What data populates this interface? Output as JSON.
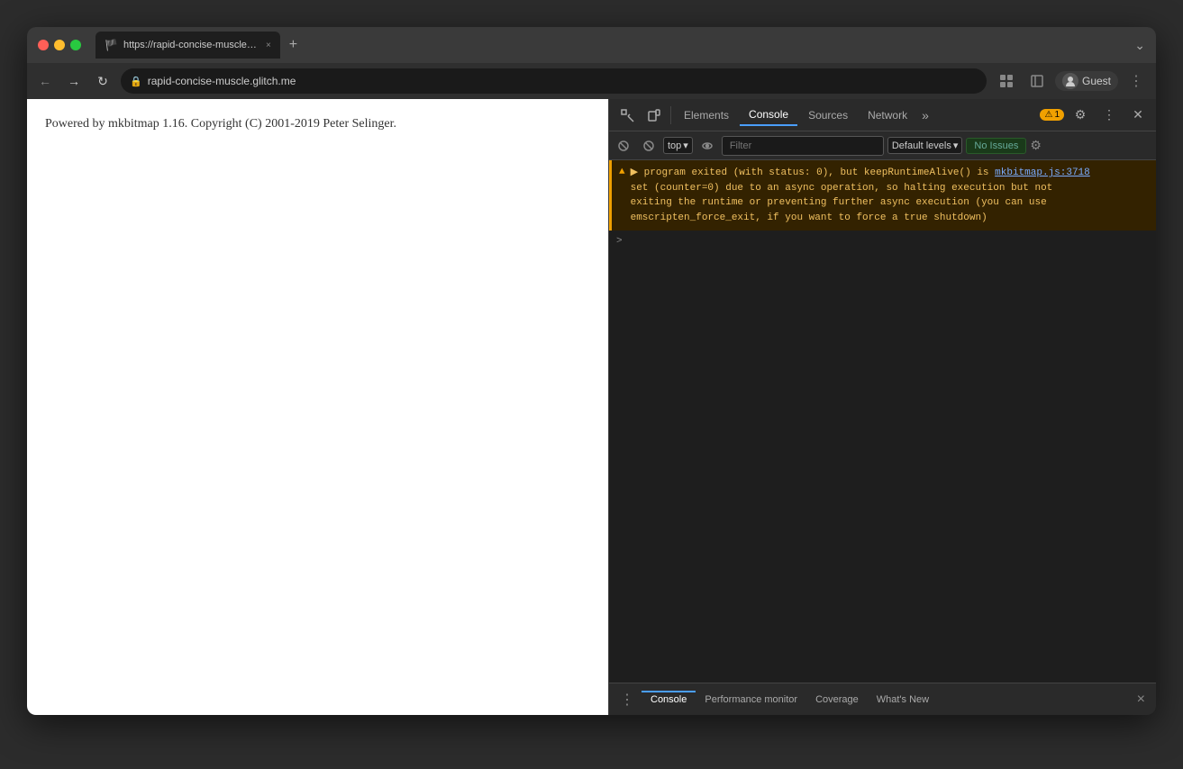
{
  "window": {
    "traffic_lights": [
      "red",
      "yellow",
      "green"
    ]
  },
  "tab": {
    "favicon": "🏴",
    "title": "https://rapid-concise-muscle.g...",
    "close": "×",
    "new_tab": "+"
  },
  "address_bar": {
    "back": "←",
    "forward": "→",
    "reload": "↻",
    "url": "rapid-concise-muscle.glitch.me",
    "lock_icon": "🔒",
    "profile_icon": "👤",
    "guest_label": "Guest",
    "more_icon": "⋮"
  },
  "page": {
    "content": "Powered by mkbitmap 1.16. Copyright (C) 2001-2019 Peter Selinger."
  },
  "devtools": {
    "tabs": [
      "Elements",
      "Console",
      "Sources",
      "Network"
    ],
    "active_tab": "Console",
    "more": "»",
    "warning_count": "1",
    "toolbar2": {
      "top_label": "top",
      "filter_placeholder": "Filter",
      "levels_label": "Default levels",
      "no_issues": "No Issues"
    },
    "console": {
      "warning_icon": "▲",
      "expand_arrow": "▶",
      "warning_text_line1": "program exited (with status: 0), but keepRuntimeAlive() is ",
      "warning_link": "mkbitmap.js:3718",
      "warning_text_line2": "set (counter=0) due to an async operation, so halting execution but not",
      "warning_text_line3": "exiting the runtime or preventing further async execution (you can use",
      "warning_text_line4": "emscripten_force_exit, if you want to force a true shutdown)",
      "prompt_arrow": ">"
    },
    "bottom_tabs": [
      "Console",
      "Performance monitor",
      "Coverage",
      "What's New"
    ],
    "active_bottom_tab": "Console",
    "bottom_menu": "⋮",
    "close": "×"
  }
}
